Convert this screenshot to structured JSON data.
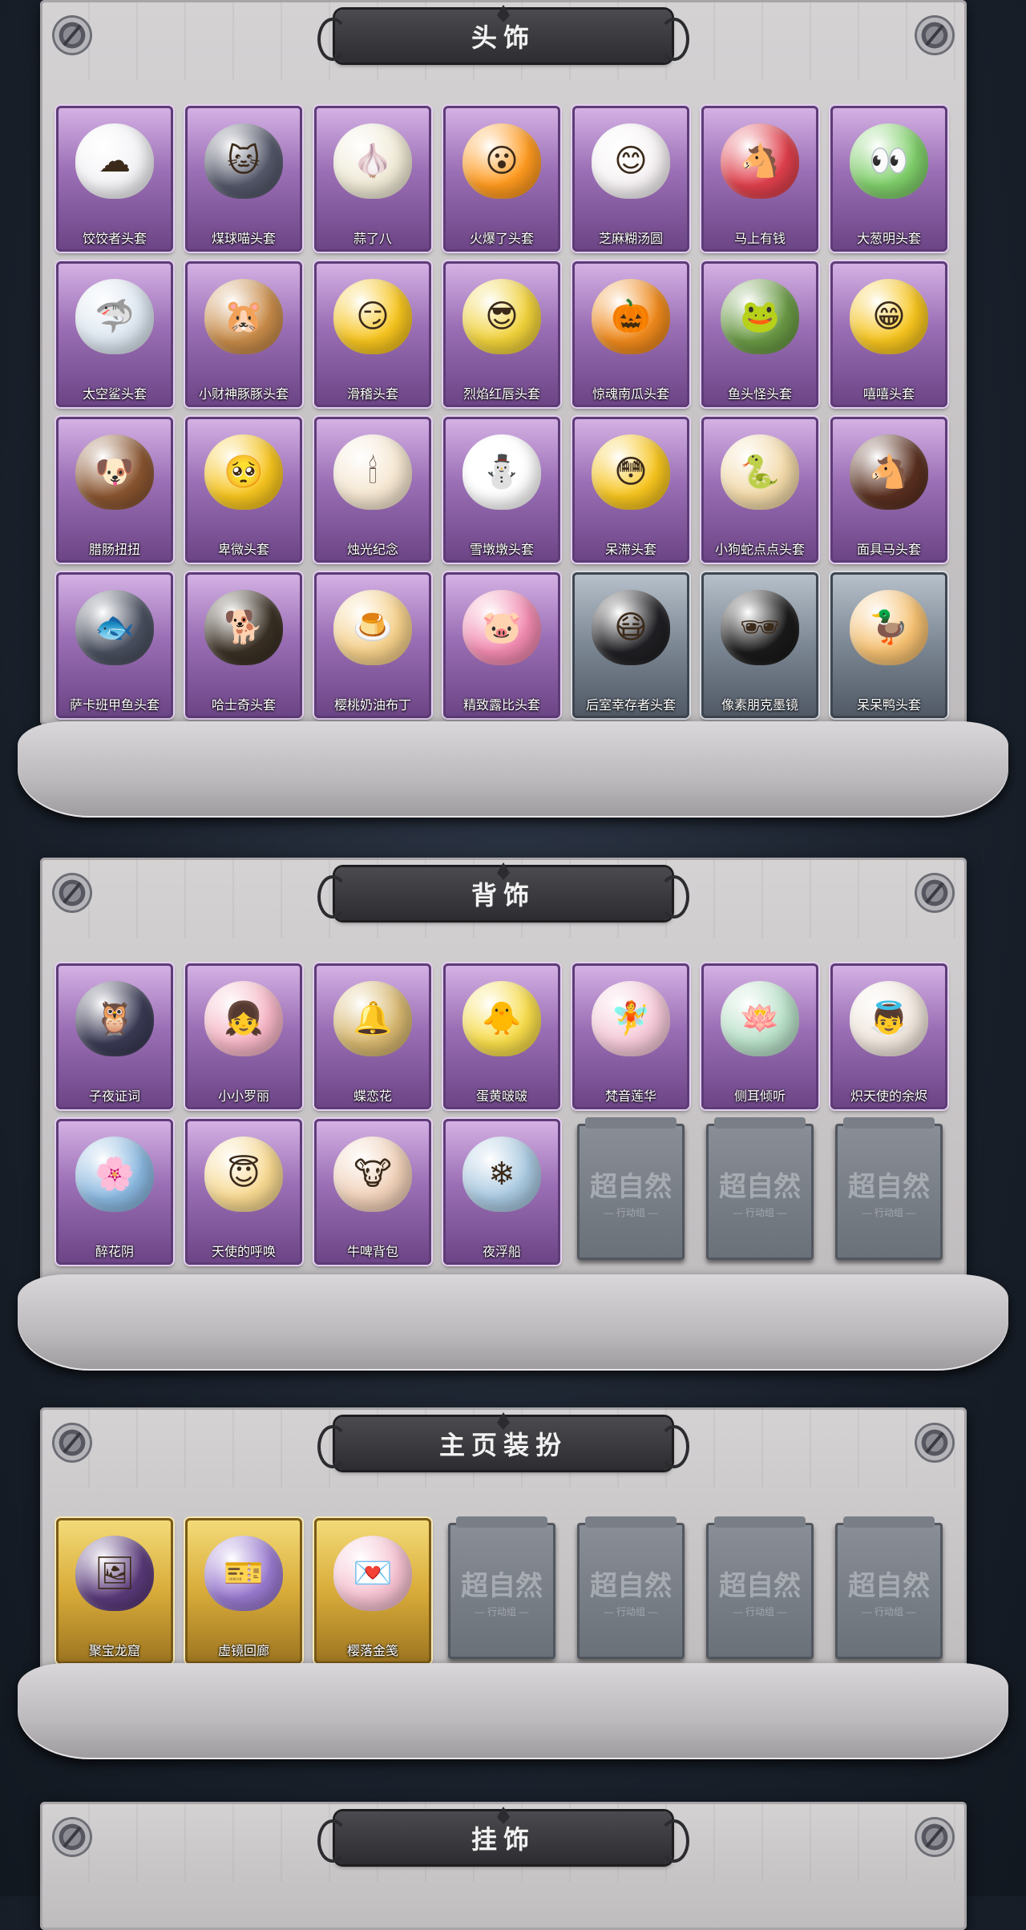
{
  "sections": {
    "head": {
      "title": "头饰",
      "items": [
        {
          "label": "饺饺者头套",
          "emoji": "☁",
          "color": "#f3f3f6",
          "style": "purple"
        },
        {
          "label": "煤球喵头套",
          "emoji": "🐱",
          "color": "#54586a",
          "style": "purple"
        },
        {
          "label": "蒜了八",
          "emoji": "🧄",
          "color": "#f0ead6",
          "style": "purple"
        },
        {
          "label": "火爆了头套",
          "emoji": "😮",
          "color": "#ff9a1e",
          "style": "purple"
        },
        {
          "label": "芝麻糊汤圆",
          "emoji": "😊",
          "color": "#f7f3f5",
          "style": "purple"
        },
        {
          "label": "马上有钱",
          "emoji": "🐴",
          "color": "#e0404c",
          "style": "purple"
        },
        {
          "label": "大葱明头套",
          "emoji": "👀",
          "color": "#7fcf6a",
          "style": "purple"
        },
        {
          "label": "太空鲨头套",
          "emoji": "🦈",
          "color": "#dce6f0",
          "style": "purple"
        },
        {
          "label": "小财神豚豚头套",
          "emoji": "🐹",
          "color": "#c98c4a",
          "style": "purple"
        },
        {
          "label": "滑稽头套",
          "emoji": "😏",
          "color": "#f7c51e",
          "style": "purple"
        },
        {
          "label": "烈焰红唇头套",
          "emoji": "😎",
          "color": "#f1d23a",
          "style": "purple"
        },
        {
          "label": "惊魂南瓜头套",
          "emoji": "🎃",
          "color": "#f08a1c",
          "style": "purple"
        },
        {
          "label": "鱼头怪头套",
          "emoji": "🐸",
          "color": "#6a9a45",
          "style": "purple"
        },
        {
          "label": "嘻嘻头套",
          "emoji": "😁",
          "color": "#f7c51e",
          "style": "purple"
        },
        {
          "label": "腊肠扭扭",
          "emoji": "🐶",
          "color": "#8a5530",
          "style": "purple"
        },
        {
          "label": "卑微头套",
          "emoji": "🥺",
          "color": "#f7c51e",
          "style": "purple"
        },
        {
          "label": "烛光纪念",
          "emoji": "🕯",
          "color": "#f5e6d0",
          "style": "purple"
        },
        {
          "label": "雪墩墩头套",
          "emoji": "⛄",
          "color": "#ffffff",
          "style": "purple"
        },
        {
          "label": "呆滞头套",
          "emoji": "😳",
          "color": "#f7c51e",
          "style": "purple"
        },
        {
          "label": "小狗蛇点点头套",
          "emoji": "🐍",
          "color": "#f2d9a8",
          "style": "purple"
        },
        {
          "label": "面具马头套",
          "emoji": "🐴",
          "color": "#5a3020",
          "style": "purple"
        },
        {
          "label": "萨卡班甲鱼头套",
          "emoji": "🐟",
          "color": "#4a5060",
          "style": "purple"
        },
        {
          "label": "哈士奇头套",
          "emoji": "🐕",
          "color": "#3a3024",
          "style": "purple"
        },
        {
          "label": "樱桃奶油布丁",
          "emoji": "🍮",
          "color": "#f5d08a",
          "style": "purple"
        },
        {
          "label": "精致露比头套",
          "emoji": "🐷",
          "color": "#f28ab0",
          "style": "purple"
        },
        {
          "label": "后室幸存者头套",
          "emoji": "😷",
          "color": "#202024",
          "style": "gray"
        },
        {
          "label": "像素朋克墨镜",
          "emoji": "🕶",
          "color": "#1a1a1a",
          "style": "gray"
        },
        {
          "label": "呆呆鸭头套",
          "emoji": "🦆",
          "color": "#f5c070",
          "style": "gray"
        }
      ]
    },
    "back": {
      "title": "背饰",
      "items": [
        {
          "label": "子夜证词",
          "emoji": "🦉",
          "color": "#3a3a55",
          "style": "purple"
        },
        {
          "label": "小小罗丽",
          "emoji": "👧",
          "color": "#f5b5c5",
          "style": "purple"
        },
        {
          "label": "蝶恋花",
          "emoji": "🔔",
          "color": "#d8b870",
          "style": "purple"
        },
        {
          "label": "蛋黄啵啵",
          "emoji": "🐥",
          "color": "#f7dc4a",
          "style": "purple"
        },
        {
          "label": "梵音莲华",
          "emoji": "🧚",
          "color": "#f5c8d8",
          "style": "purple"
        },
        {
          "label": "侧耳倾听",
          "emoji": "🪷",
          "color": "#b8e0c8",
          "style": "purple"
        },
        {
          "label": "炽天使的余烬",
          "emoji": "👼",
          "color": "#f0e6dc",
          "style": "purple"
        },
        {
          "label": "醉花阴",
          "emoji": "🌸",
          "color": "#8ab8e0",
          "style": "purple"
        },
        {
          "label": "天使的呼唤",
          "emoji": "😇",
          "color": "#f7d890",
          "style": "purple"
        },
        {
          "label": "牛啤背包",
          "emoji": "🐮",
          "color": "#f0d0b8",
          "style": "purple"
        },
        {
          "label": "夜浮船",
          "emoji": "❄",
          "color": "#a8c8e0",
          "style": "purple"
        }
      ],
      "empty_slots": 3
    },
    "home": {
      "title": "主页装扮",
      "items": [
        {
          "label": "聚宝龙窟",
          "emoji": "🖼",
          "color": "#5a3a7a",
          "style": "gold"
        },
        {
          "label": "虚镜回廊",
          "emoji": "🎫",
          "color": "#9a7ad0",
          "style": "gold"
        },
        {
          "label": "樱落金笺",
          "emoji": "💌",
          "color": "#f5c0d0",
          "style": "gold"
        }
      ],
      "empty_slots": 4
    },
    "hang": {
      "title": "挂饰"
    }
  },
  "placeholder": {
    "watermark": "超自然",
    "sub": "— 行动组 —"
  }
}
